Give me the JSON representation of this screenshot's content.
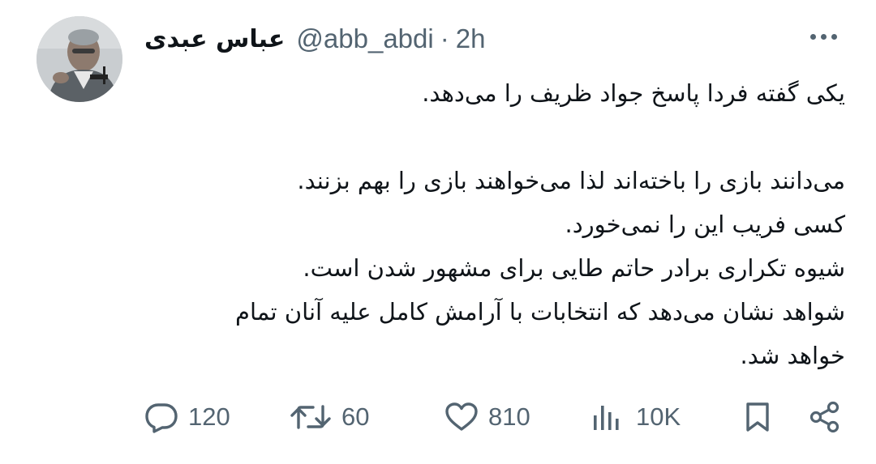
{
  "author": {
    "display_name": "عباس عبدی",
    "handle": "@abb_abdi",
    "separator": "·",
    "time": "2h"
  },
  "tweet": {
    "lines": [
      "یکی گفته فردا پاسخ جواد ظریف را می‌دهد.",
      "",
      "می‌دانند بازی را باخته‌اند لذا می‌خواهند بازی را بهم بزنند.",
      "کسی فریب این را نمی‌خورد.",
      "شیوه تکراری برادر حاتم طایی برای مشهور شدن است.",
      "شواهد نشان می‌دهد که انتخابات با آرامش کامل علیه آنان تمام",
      "خواهد شد."
    ]
  },
  "actions": {
    "replies": "120",
    "retweets": "60",
    "likes": "810",
    "views": "10K"
  },
  "icons": {
    "more": "more-icon",
    "reply": "reply-icon",
    "retweet": "retweet-icon",
    "like": "heart-icon",
    "views": "views-icon",
    "bookmark": "bookmark-icon",
    "share": "share-icon"
  },
  "colors": {
    "text": "#0f1419",
    "secondary": "#536471"
  }
}
